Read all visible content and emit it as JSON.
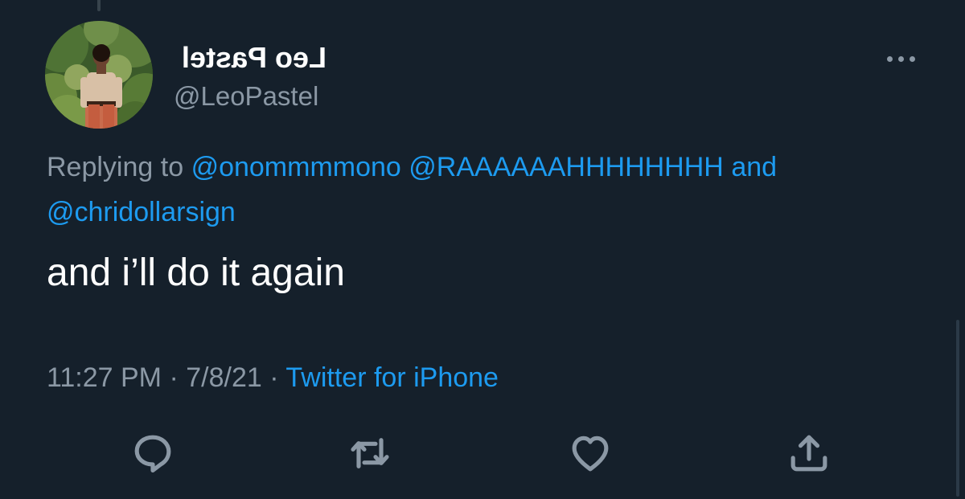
{
  "tweet": {
    "display_name": "Leo Pastel",
    "handle": "@LeoPastel",
    "reply": {
      "prefix": "Replying to",
      "mentions": [
        "@onommmmono",
        "@RAAAAAAHHHHHHHH",
        "@chridollarsign"
      ],
      "conjunction": "and"
    },
    "text": "and i’ll do it again",
    "time": "11:27 PM",
    "separator": "·",
    "date": "7/8/21",
    "source": "Twitter for iPhone"
  },
  "icons": {
    "more": "more-horizontal-icon",
    "reply": "reply-icon",
    "retweet": "retweet-icon",
    "like": "heart-icon",
    "share": "share-icon"
  },
  "colors": {
    "background": "#15202b",
    "text": "#ffffff",
    "secondary_text": "#8b98a5",
    "link": "#1d9bf0"
  }
}
